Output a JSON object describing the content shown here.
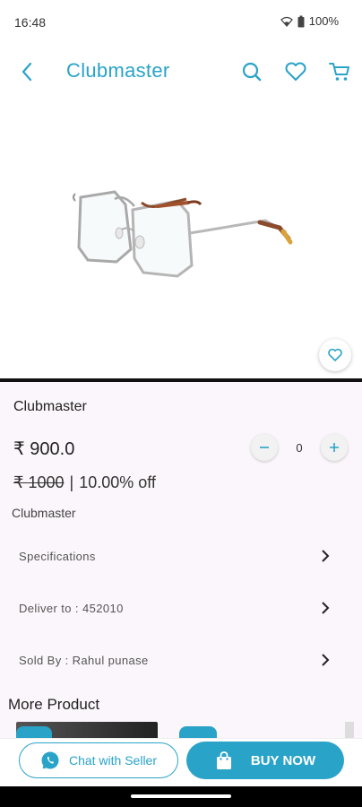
{
  "status": {
    "time": "16:48",
    "battery": "100%"
  },
  "header": {
    "title": "Clubmaster"
  },
  "product": {
    "name": "Clubmaster",
    "price": "₹ 900.0",
    "mrp": "₹ 1000",
    "separator": "|",
    "discount": "10.00% off",
    "description": "Clubmaster",
    "quantity": "0"
  },
  "rows": [
    {
      "label": "Specifications"
    },
    {
      "label": "Deliver to : 452010"
    },
    {
      "label": "Sold By : Rahul punase"
    }
  ],
  "more": {
    "title": "More Product"
  },
  "actions": {
    "chat_label": "Chat with Seller",
    "buy_label": "BUY NOW"
  },
  "colors": {
    "accent": "#2aa3c8",
    "details_bg": "#fbf6fb",
    "whatsapp": "#2aa3c8"
  },
  "icons": [
    "back-arrow-icon",
    "search-icon",
    "heart-icon",
    "cart-icon",
    "whatsapp-icon",
    "shopping-bag-icon",
    "chevron-right-icon"
  ]
}
